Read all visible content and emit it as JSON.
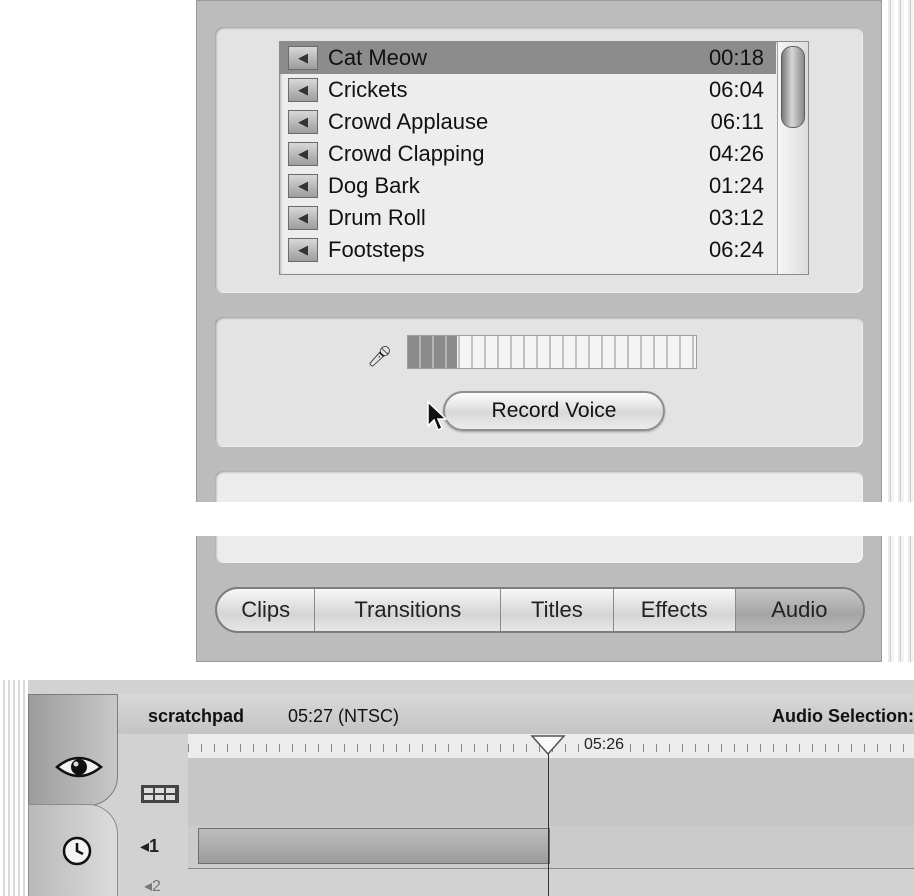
{
  "audio_list": {
    "items": [
      {
        "name": "Cat Meow",
        "time": "00:18",
        "selected": true
      },
      {
        "name": "Crickets",
        "time": "06:04",
        "selected": false
      },
      {
        "name": "Crowd Applause",
        "time": "06:11",
        "selected": false
      },
      {
        "name": "Crowd Clapping",
        "time": "04:26",
        "selected": false
      },
      {
        "name": "Dog Bark",
        "time": "01:24",
        "selected": false
      },
      {
        "name": "Drum Roll",
        "time": "03:12",
        "selected": false
      },
      {
        "name": "Footsteps",
        "time": "06:24",
        "selected": false
      }
    ]
  },
  "recorder": {
    "level_fraction": 0.17,
    "record_label": "Record Voice"
  },
  "tabs": [
    {
      "label": "Clips",
      "active": false
    },
    {
      "label": "Transitions",
      "active": false
    },
    {
      "label": "Titles",
      "active": false
    },
    {
      "label": "Effects",
      "active": false
    },
    {
      "label": "Audio",
      "active": true
    }
  ],
  "timeline": {
    "project_name": "scratchpad",
    "project_duration": "05:27 (NTSC)",
    "selection_label": "Audio Selection:",
    "playhead_time": "05:26",
    "audio_track_label": "◂1",
    "audio_track2_label": "◂2"
  },
  "icons": {
    "speaker": "speaker-icon",
    "mic": "microphone-icon",
    "eye": "eye-icon",
    "clock": "clock-icon",
    "film": "film-icon"
  }
}
